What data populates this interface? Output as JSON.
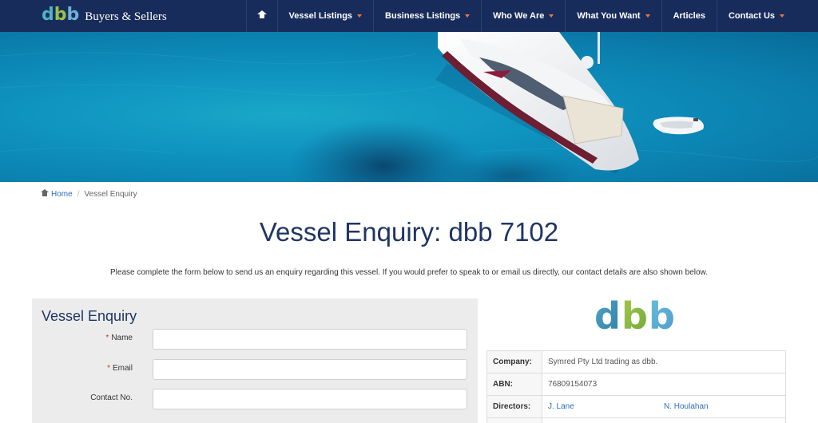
{
  "brand": {
    "mark_d": "d",
    "mark_b1": "b",
    "mark_b2": "b",
    "text": "Buyers & Sellers"
  },
  "nav": {
    "home_icon": "home-icon",
    "items": [
      {
        "label": "Vessel Listings",
        "dropdown": true
      },
      {
        "label": "Business Listings",
        "dropdown": true
      },
      {
        "label": "Who We Are",
        "dropdown": true
      },
      {
        "label": "What You Want",
        "dropdown": true
      },
      {
        "label": "Articles",
        "dropdown": false
      },
      {
        "label": "Contact Us",
        "dropdown": true
      }
    ],
    "caret_color": "#e97a3f",
    "bg_color": "#172c5a"
  },
  "breadcrumb": {
    "home": "Home",
    "current": "Vessel Enquiry"
  },
  "page": {
    "title": "Vessel Enquiry: dbb 7102",
    "intro": "Please complete the form below to send us an enquiry regarding this vessel. If you would prefer to speak to or email us directly, our contact details are also shown below."
  },
  "form": {
    "title": "Vessel Enquiry",
    "fields": [
      {
        "label": "Name",
        "required": true,
        "value": ""
      },
      {
        "label": "Email",
        "required": true,
        "value": ""
      },
      {
        "label": "Contact No.",
        "required": false,
        "value": ""
      }
    ],
    "required_marker": "*"
  },
  "company": {
    "logo_text": "dbb",
    "rows": [
      {
        "key": "Company:",
        "value": "Symred Pty Ltd trading as dbb."
      },
      {
        "key": "ABN:",
        "value": "76809154073"
      },
      {
        "key": "Directors:",
        "value": ""
      }
    ],
    "directors": [
      "J. Lane",
      "N. Houlahan"
    ]
  }
}
